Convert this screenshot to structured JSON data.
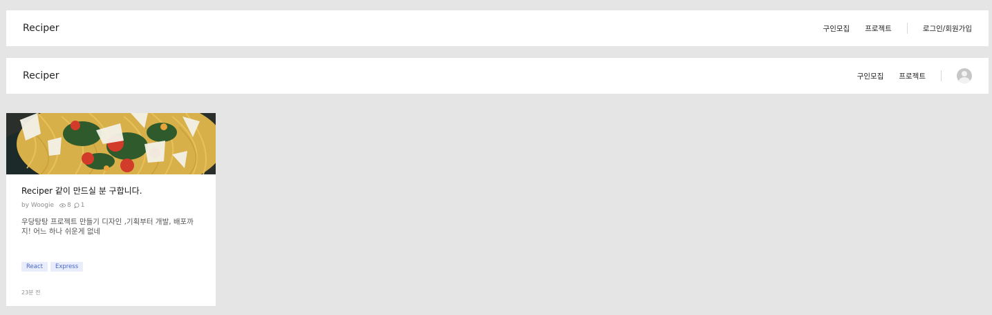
{
  "navbar_guest": {
    "logo": "Reciper",
    "links": [
      "구인모집",
      "프로젝트"
    ],
    "auth_link": "로그인/회원가입"
  },
  "navbar_user": {
    "logo": "Reciper",
    "links": [
      "구인모집",
      "프로젝트"
    ],
    "avatar_icon": "user-avatar-icon"
  },
  "card": {
    "image_icon": "pasta-photo",
    "title": "Reciper 같이 만드실 분 구합니다.",
    "author": "by Woogie",
    "views": "8",
    "comments": "1",
    "description": "우당탕탕 프로젝트 만들기 디자인 ,기획부터 개발, 배포까지! 어느 하나 쉬운게 없네",
    "tags": [
      "React",
      "Express"
    ],
    "time": "23분 전"
  },
  "colors": {
    "background": "#e5e5e5",
    "surface": "#ffffff",
    "tag_bg": "#e8ecfb",
    "tag_text": "#4a67c9"
  }
}
